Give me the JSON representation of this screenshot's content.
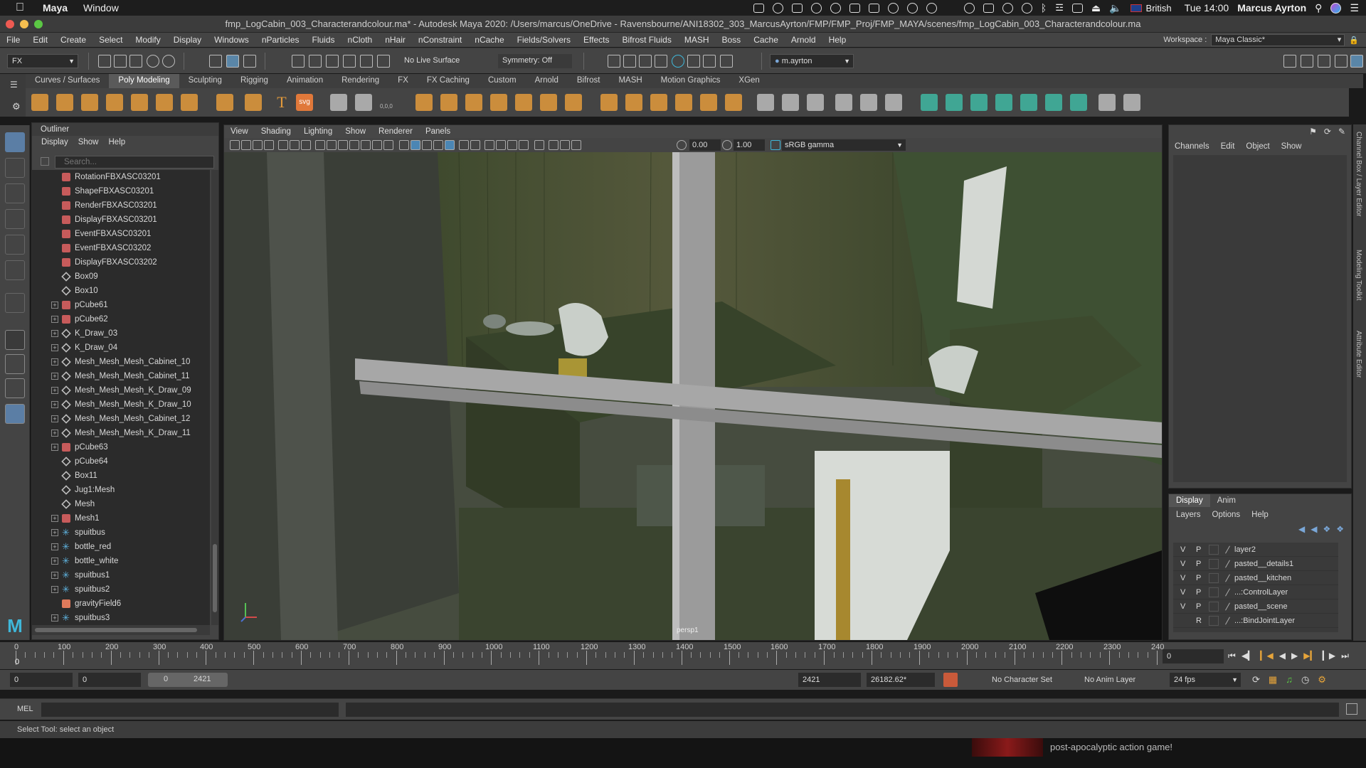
{
  "macbar": {
    "app": "Maya",
    "menu": [
      "Window"
    ],
    "keyboard": "British",
    "clock": "Tue 14:00",
    "user": "Marcus Ayrton"
  },
  "window_title": "fmp_LogCabin_003_Characterandcolour.ma* - Autodesk Maya 2020: /Users/marcus/OneDrive - Ravensbourne/ANI18302_303_MarcusAyrton/FMP/FMP_Proj/FMP_MAYA/scenes/fmp_LogCabin_003_Characterandcolour.ma",
  "maya_menu": [
    "File",
    "Edit",
    "Create",
    "Select",
    "Modify",
    "Display",
    "Windows",
    "nParticles",
    "Fluids",
    "nCloth",
    "nHair",
    "nConstraint",
    "nCache",
    "Fields/Solvers",
    "Effects",
    "Bifrost Fluids",
    "MASH",
    "Boss",
    "Cache",
    "Arnold",
    "Help"
  ],
  "workspace": {
    "label": "Workspace :",
    "value": "Maya Classic*"
  },
  "statusline": {
    "menuset": "FX",
    "live_surface": "No Live Surface",
    "symmetry": "Symmetry: Off",
    "user": "m.ayrton"
  },
  "shelf_tabs": [
    "Curves / Surfaces",
    "Poly Modeling",
    "Sculpting",
    "Rigging",
    "Animation",
    "Rendering",
    "FX",
    "FX Caching",
    "Custom",
    "Arnold",
    "Bifrost",
    "MASH",
    "Motion Graphics",
    "XGen"
  ],
  "shelf_active": "Poly Modeling",
  "shelf_text_icons": {
    "text": "T",
    "svg": "svg",
    "coords": "0,0,0"
  },
  "outliner": {
    "title": "Outliner",
    "menu": [
      "Display",
      "Show",
      "Help"
    ],
    "search_placeholder": "Search...",
    "rows": [
      {
        "label": "RotationFBXASC03201",
        "expand": false,
        "icon": "node-icon"
      },
      {
        "label": "ShapeFBXASC03201",
        "expand": false,
        "icon": "node-icon"
      },
      {
        "label": "RenderFBXASC03201",
        "expand": false,
        "icon": "node-icon"
      },
      {
        "label": "DisplayFBXASC03201",
        "expand": false,
        "icon": "node-icon"
      },
      {
        "label": "EventFBXASC03201",
        "expand": false,
        "icon": "node-icon"
      },
      {
        "label": "EventFBXASC03202",
        "expand": false,
        "icon": "node-icon"
      },
      {
        "label": "DisplayFBXASC03202",
        "expand": false,
        "icon": "node-icon"
      },
      {
        "label": "Box09",
        "expand": false,
        "icon": "transform-icon"
      },
      {
        "label": "Box10",
        "expand": false,
        "icon": "transform-icon"
      },
      {
        "label": "pCube61",
        "expand": true,
        "icon": "node-icon"
      },
      {
        "label": "pCube62",
        "expand": true,
        "icon": "node-icon"
      },
      {
        "label": "K_Draw_03",
        "expand": true,
        "icon": "transform-icon"
      },
      {
        "label": "K_Draw_04",
        "expand": true,
        "icon": "transform-icon"
      },
      {
        "label": "Mesh_Mesh_Mesh_Cabinet_10",
        "expand": true,
        "icon": "transform-icon"
      },
      {
        "label": "Mesh_Mesh_Mesh_Cabinet_11",
        "expand": true,
        "icon": "transform-icon"
      },
      {
        "label": "Mesh_Mesh_Mesh_K_Draw_09",
        "expand": true,
        "icon": "transform-icon"
      },
      {
        "label": "Mesh_Mesh_Mesh_K_Draw_10",
        "expand": true,
        "icon": "transform-icon"
      },
      {
        "label": "Mesh_Mesh_Mesh_Cabinet_12",
        "expand": true,
        "icon": "transform-icon"
      },
      {
        "label": "Mesh_Mesh_Mesh_K_Draw_11",
        "expand": true,
        "icon": "transform-icon"
      },
      {
        "label": "pCube63",
        "expand": true,
        "icon": "node-icon"
      },
      {
        "label": "pCube64",
        "expand": false,
        "icon": "transform-icon"
      },
      {
        "label": "Box11",
        "expand": false,
        "icon": "transform-icon"
      },
      {
        "label": "Jug1:Mesh",
        "expand": false,
        "icon": "transform-icon"
      },
      {
        "label": "Mesh",
        "expand": false,
        "icon": "transform-icon"
      },
      {
        "label": "Mesh1",
        "expand": true,
        "icon": "node-icon"
      },
      {
        "label": "spuitbus",
        "expand": true,
        "icon": "joint-icon"
      },
      {
        "label": "bottle_red",
        "expand": true,
        "icon": "joint-icon"
      },
      {
        "label": "bottle_white",
        "expand": true,
        "icon": "joint-icon"
      },
      {
        "label": "spuitbus1",
        "expand": true,
        "icon": "joint-icon"
      },
      {
        "label": "spuitbus2",
        "expand": true,
        "icon": "joint-icon"
      },
      {
        "label": "gravityField6",
        "expand": false,
        "icon": "field-icon"
      },
      {
        "label": "spuitbus3",
        "expand": true,
        "icon": "joint-icon"
      }
    ]
  },
  "viewport": {
    "menu": [
      "View",
      "Shading",
      "Lighting",
      "Show",
      "Renderer",
      "Panels"
    ],
    "exposure": "0.00",
    "gamma": "1.00",
    "colorspace": "sRGB gamma",
    "camera": "persp1"
  },
  "channelbox": {
    "menu": [
      "Channels",
      "Edit",
      "Object",
      "Show"
    ]
  },
  "layers": {
    "tabs": [
      "Display",
      "Anim"
    ],
    "menu": [
      "Layers",
      "Options",
      "Help"
    ],
    "rows": [
      {
        "v": "V",
        "p": "P",
        "name": "layer2"
      },
      {
        "v": "V",
        "p": "P",
        "name": "pasted__details1"
      },
      {
        "v": "V",
        "p": "P",
        "name": "pasted__kitchen"
      },
      {
        "v": "V",
        "p": "P",
        "name": "...:ControlLayer"
      },
      {
        "v": "V",
        "p": "P",
        "name": "pasted__scene"
      },
      {
        "v": "",
        "p": "R",
        "name": "...:BindJointLayer"
      }
    ]
  },
  "side_tabs": [
    "Channel Box / Layer Editor",
    "Modeling Toolkit",
    "Attribute Editor"
  ],
  "timeline": {
    "labels": [
      "0",
      "100",
      "200",
      "300",
      "400",
      "500",
      "600",
      "700",
      "800",
      "900",
      "1000",
      "1100",
      "1200",
      "1300",
      "1400",
      "1500",
      "1600",
      "1700",
      "1800",
      "1900",
      "2000",
      "2100",
      "2200",
      "2300",
      "240"
    ],
    "current_frame_marker": "0",
    "current_frame_field": "0"
  },
  "range": {
    "start": "0",
    "anim_start": "0",
    "slider_start": "0",
    "slider_end": "2421",
    "end": "2421",
    "anim_end": "26182.62*",
    "character_set": "No Character Set",
    "anim_layer": "No Anim Layer",
    "fps": "24 fps"
  },
  "cmdline": {
    "label": "MEL"
  },
  "helpline": "Select Tool: select an object",
  "desktop_text": "post-apocalyptic action game!"
}
